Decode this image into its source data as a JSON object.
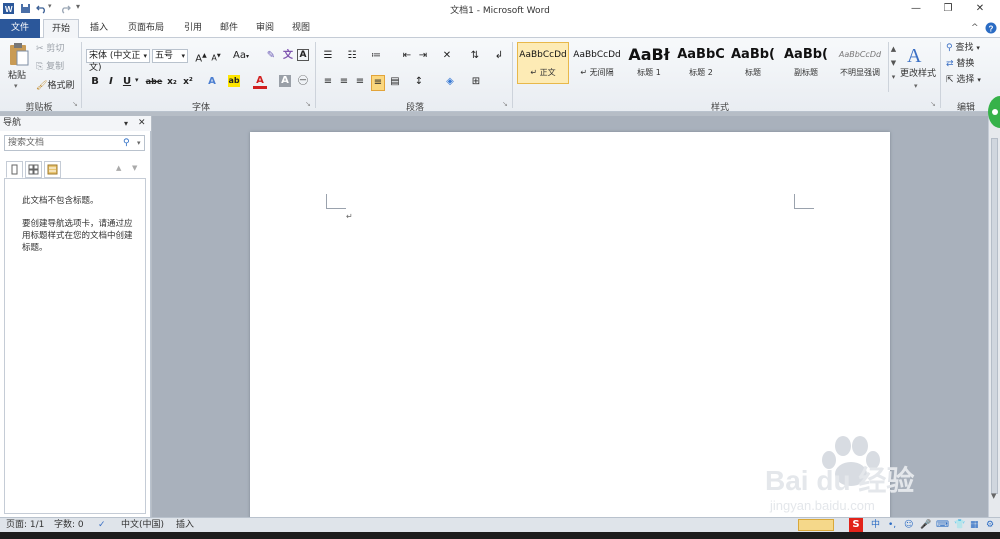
{
  "window": {
    "title": "文档1 - Microsoft Word",
    "controls": [
      "—",
      "❐",
      "✕"
    ]
  },
  "tabs": [
    {
      "label": "文件"
    },
    {
      "label": "开始"
    },
    {
      "label": "插入"
    },
    {
      "label": "页面布局"
    },
    {
      "label": "引用"
    },
    {
      "label": "邮件"
    },
    {
      "label": "审阅"
    },
    {
      "label": "视图"
    }
  ],
  "ribbon": {
    "clipboard": {
      "paste": "粘贴",
      "cut": "剪切",
      "copy": "复制",
      "format_painter": "格式刷",
      "label": "剪贴板"
    },
    "font": {
      "font_name": "宋体 (中文正文)",
      "font_size": "五号",
      "label": "字体",
      "row2": [
        "B",
        "I",
        "U",
        "abe",
        "x₂",
        "x²"
      ]
    },
    "paragraph": {
      "label": "段落"
    },
    "styles": {
      "label": "样式",
      "items": [
        {
          "preview": "AaBbCcDd",
          "label": "↵ 正文",
          "selected": true
        },
        {
          "preview": "AaBbCcDd",
          "label": "↵ 无间隔",
          "selected": false
        },
        {
          "preview": "AaBł",
          "label": "标题 1",
          "selected": false
        },
        {
          "preview": "AaBbC",
          "label": "标题 2",
          "selected": false
        },
        {
          "preview": "AaBb(",
          "label": "标题",
          "selected": false
        },
        {
          "preview": "AaBb(",
          "label": "副标题",
          "selected": false
        },
        {
          "preview": "AaBbCcDd",
          "label": "不明显强调",
          "selected": false
        }
      ],
      "change_styles": "更改样式"
    },
    "editing": {
      "label": "编辑",
      "find": "查找",
      "replace": "替换",
      "select": "选择"
    }
  },
  "nav": {
    "title": "导航",
    "search_placeholder": "搜索文档",
    "message1": "此文档不包含标题。",
    "message2": "要创建导航选项卡，请通过应用标题样式在您的文档中创建标题。"
  },
  "status": {
    "page": "页面: 1/1",
    "words": "字数: 0",
    "language": "中文(中国)",
    "mode": "插入",
    "ime": "中"
  },
  "watermark": {
    "line1": "Bai du 经验",
    "line2": "jingyan.baidu.com"
  },
  "colors": {
    "file_tab": "#2b579a",
    "style_selected": "#fdebb5"
  }
}
